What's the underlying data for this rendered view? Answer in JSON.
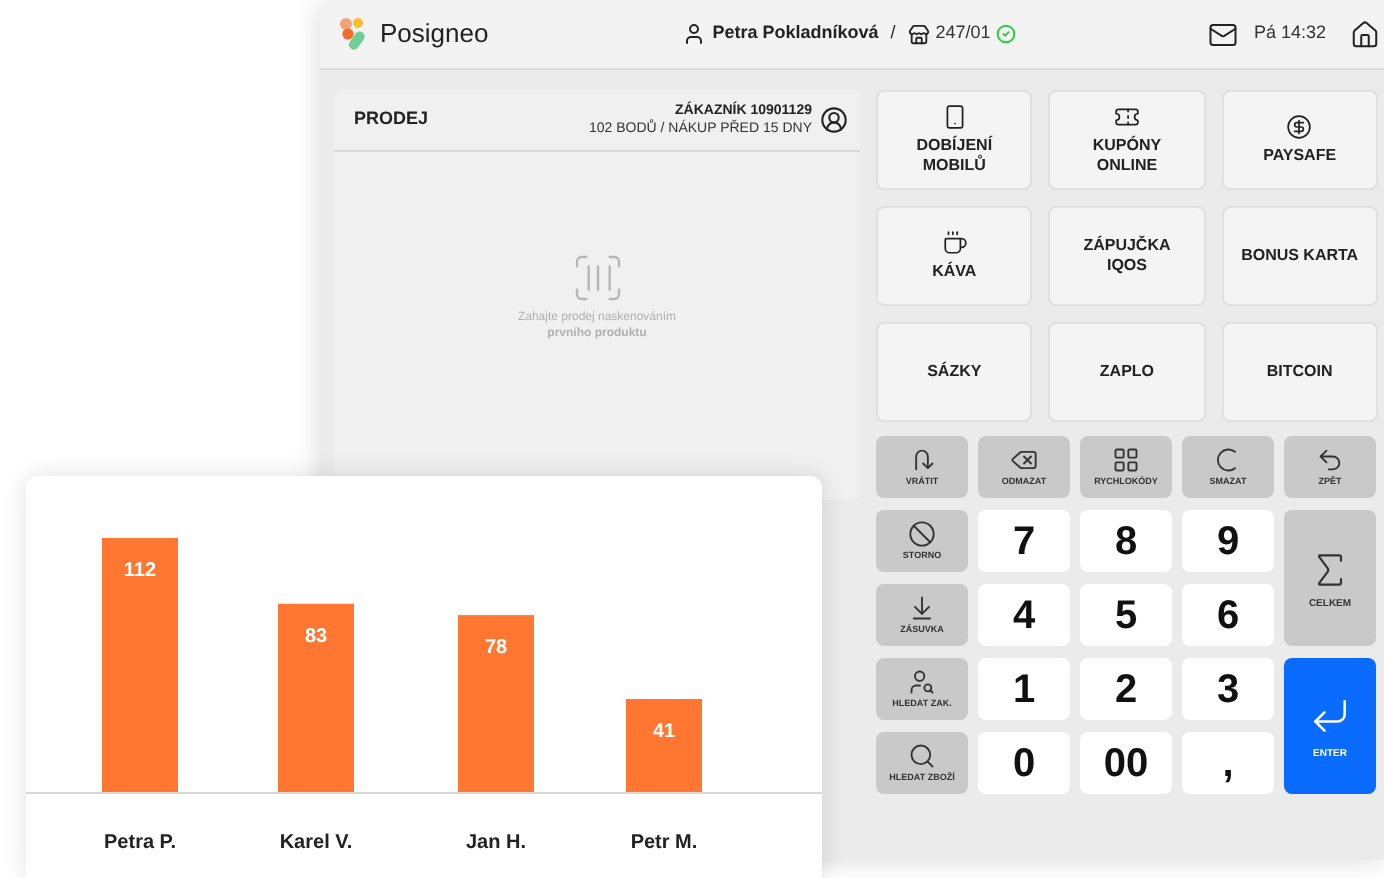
{
  "header": {
    "app_name": "Posigneo",
    "user": "Petra Pokladníková",
    "separator": "/",
    "register": "247/01",
    "register_online": true,
    "time": "Pá 14:32"
  },
  "sale_panel": {
    "title": "PRODEJ",
    "customer_title": "ZÁKAZNÍK 10901129",
    "customer_info": "102 BODŮ / NÁKUP PŘED 15 DNY",
    "empty_hint": "Zahajte prodej naskenováním **prvního produktu**"
  },
  "quick_buttons": [
    {
      "label": "DOBÍJENÍ MOBILŮ"
    },
    {
      "label": "KUPÓNY ONLINE"
    },
    {
      "label": "PAYSAFE"
    },
    {
      "label": "KÁVA"
    },
    {
      "label": "ZÁPUJČKA IQOS"
    },
    {
      "label": "BONUS KARTA"
    },
    {
      "label": "SÁZKY"
    },
    {
      "label": "ZAPLO"
    },
    {
      "label": "BITCOIN"
    }
  ],
  "function_keys": [
    {
      "label": "VRÁTIT"
    },
    {
      "label": "ODMAZAT"
    },
    {
      "label": "RYCHLOKÓDY"
    },
    {
      "label": "SMAZAT"
    },
    {
      "label": "ZPĚT"
    }
  ],
  "keypad": [
    {
      "kind": "function",
      "label": "STORNO"
    },
    {
      "kind": "digit",
      "label": "7"
    },
    {
      "kind": "digit",
      "label": "8"
    },
    {
      "kind": "digit",
      "label": "9"
    },
    {
      "kind": "total",
      "label": "CELKEM"
    },
    {
      "kind": "function",
      "label": "ZÁSUVKA"
    },
    {
      "kind": "digit",
      "label": "4"
    },
    {
      "kind": "digit",
      "label": "5"
    },
    {
      "kind": "digit",
      "label": "6"
    },
    {
      "kind": "function",
      "label": "HLEDAT ZAK."
    },
    {
      "kind": "digit",
      "label": "1"
    },
    {
      "kind": "digit",
      "label": "2"
    },
    {
      "kind": "digit",
      "label": "3"
    },
    {
      "kind": "enter",
      "label": "ENTER"
    },
    {
      "kind": "function",
      "label": "HLEDAT ZBOŽÍ"
    },
    {
      "kind": "digit",
      "label": "0"
    },
    {
      "kind": "digit",
      "label": "00"
    },
    {
      "kind": "digit",
      "label": ","
    }
  ],
  "sales_chart": {
    "chart_data": {
      "type": "bar",
      "categories": [
        "Petra P.",
        "Karel V.",
        "Jan H.",
        "Petr M."
      ],
      "series": [
        {
          "color": "#ff7730",
          "values": [
            112,
            83,
            78,
            41
          ]
        }
      ],
      "data_labels": true
    }
  }
}
